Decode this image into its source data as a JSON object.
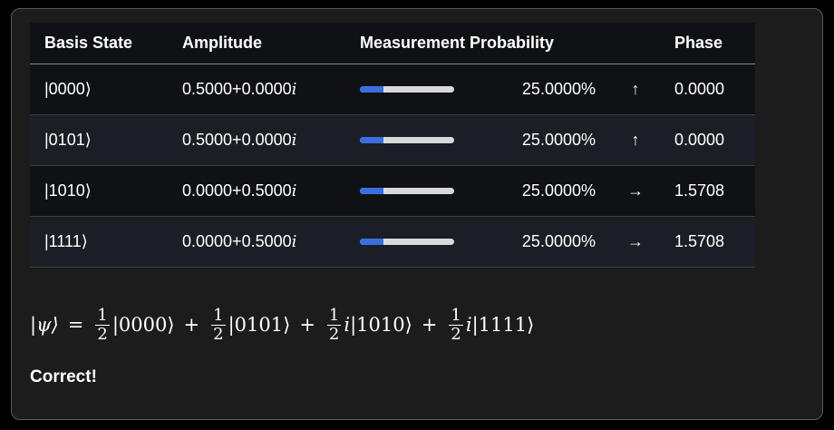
{
  "table": {
    "headers": {
      "basis": "Basis State",
      "amplitude": "Amplitude",
      "probability": "Measurement Probability",
      "phase": "Phase"
    },
    "rows": [
      {
        "basis": "|0000⟩",
        "amp_main": "0.5000+0.0000",
        "amp_unit": "i",
        "prob_fraction": 0.25,
        "prob_text": "25.0000%",
        "arrow": "↑",
        "phase": "0.0000"
      },
      {
        "basis": "|0101⟩",
        "amp_main": "0.5000+0.0000",
        "amp_unit": "i",
        "prob_fraction": 0.25,
        "prob_text": "25.0000%",
        "arrow": "↑",
        "phase": "0.0000"
      },
      {
        "basis": "|1010⟩",
        "amp_main": "0.0000+0.5000",
        "amp_unit": "i",
        "prob_fraction": 0.25,
        "prob_text": "25.0000%",
        "arrow": "→",
        "phase": "1.5708"
      },
      {
        "basis": "|1111⟩",
        "amp_main": "0.0000+0.5000",
        "amp_unit": "i",
        "prob_fraction": 0.25,
        "prob_text": "25.0000%",
        "arrow": "→",
        "phase": "1.5708"
      }
    ]
  },
  "formula": {
    "lhs": "|ψ⟩",
    "equals": "=",
    "terms": [
      {
        "num": "1",
        "den": "2",
        "coef": "",
        "ket": "|0000⟩"
      },
      {
        "num": "1",
        "den": "2",
        "coef": "",
        "ket": "|0101⟩"
      },
      {
        "num": "1",
        "den": "2",
        "coef": "i",
        "ket": "|1010⟩"
      },
      {
        "num": "1",
        "den": "2",
        "coef": "i",
        "ket": "|1111⟩"
      }
    ],
    "plus": "+"
  },
  "status": "Correct!",
  "colors": {
    "bar_fill": "#3a6fe0",
    "bar_track": "#d9d9d9"
  }
}
